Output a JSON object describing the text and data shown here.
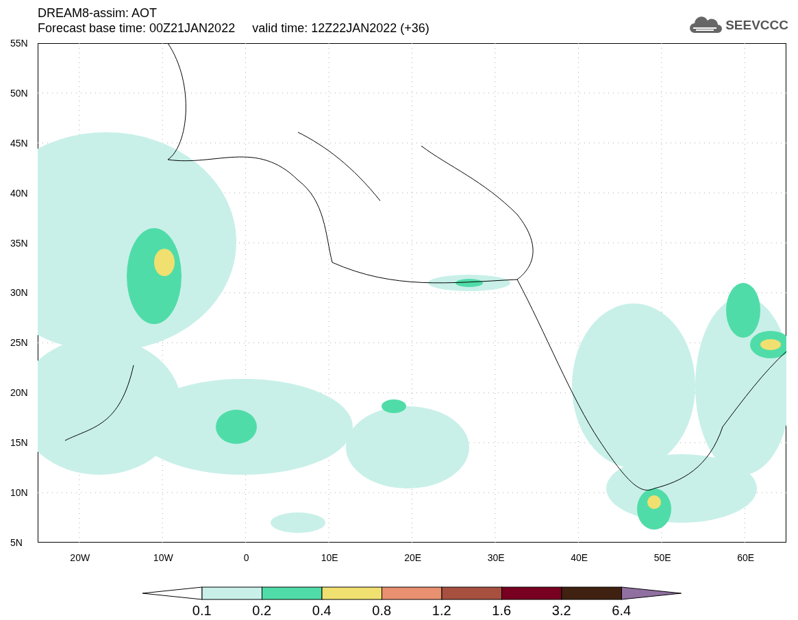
{
  "title": {
    "line_1": "DREAM8-assim: AOT",
    "line_2": "Forecast base time: 00Z21JAN2022     valid time: 12Z22JAN2022 (+36)"
  },
  "logo": {
    "text": "SEEVCCC"
  },
  "map": {
    "y_ticks": [
      "55N",
      "50N",
      "45N",
      "40N",
      "35N",
      "30N",
      "25N",
      "20N",
      "15N",
      "10N",
      "5N"
    ],
    "x_ticks": [
      "20W",
      "10W",
      "0",
      "10E",
      "20E",
      "30E",
      "40E",
      "50E",
      "60E"
    ]
  },
  "colorbar": {
    "low_end": {
      "color": "#ffffff"
    },
    "segments": [
      {
        "color": "#c8f0e8"
      },
      {
        "color": "#50dca8"
      },
      {
        "color": "#f0e070"
      },
      {
        "color": "#e89070"
      },
      {
        "color": "#a85040"
      },
      {
        "color": "#780020"
      },
      {
        "color": "#402010"
      }
    ],
    "high_end": {
      "color": "#9070a0"
    },
    "labels": [
      "0.1",
      "0.2",
      "0.4",
      "0.8",
      "1.2",
      "1.6",
      "3.2",
      "6.4"
    ]
  }
}
